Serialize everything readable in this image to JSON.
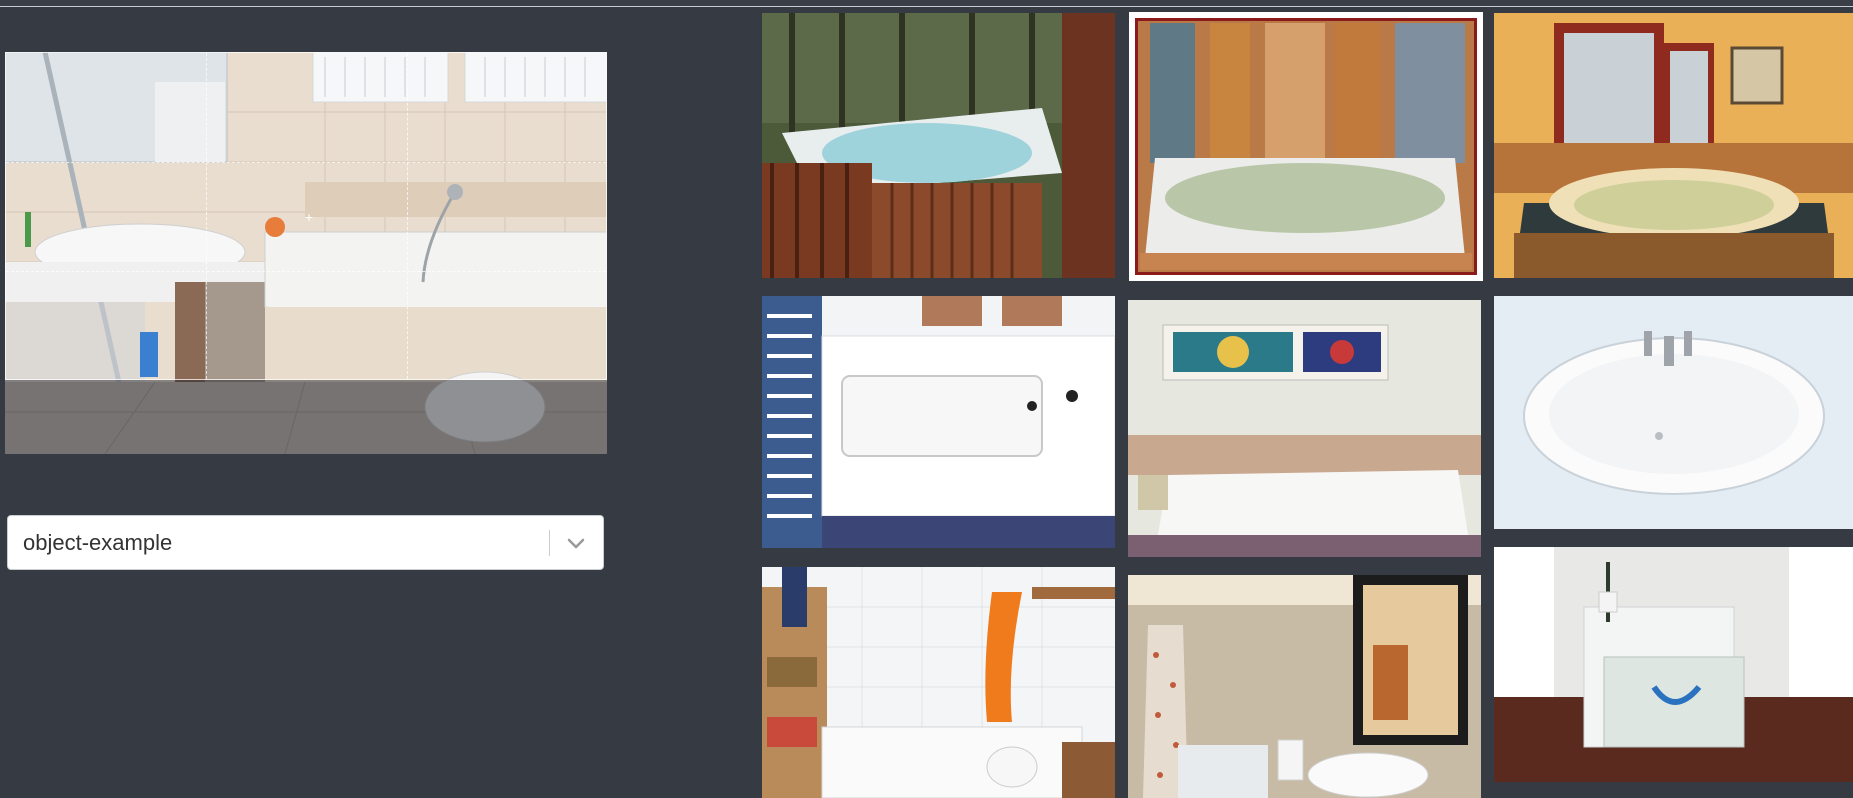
{
  "select": {
    "value": "object-example"
  },
  "editor": {
    "image": "bathroom-with-tub-and-shower"
  },
  "gallery": {
    "thumbnails": [
      {
        "name": "outdoor-hot-tub"
      },
      {
        "name": "indoor-jacuzzi",
        "selected": true
      },
      {
        "name": "corner-whirlpool"
      },
      {
        "name": "walk-in-tub"
      },
      {
        "name": "jetted-tub-stained-glass"
      },
      {
        "name": "oval-drop-in-tub"
      },
      {
        "name": "bathtub-orange-curtain"
      },
      {
        "name": "tub-with-mirror"
      },
      {
        "name": "freestanding-tub"
      }
    ]
  },
  "colors": {
    "background": "#363a42",
    "selected_outline": "#ffffff"
  }
}
